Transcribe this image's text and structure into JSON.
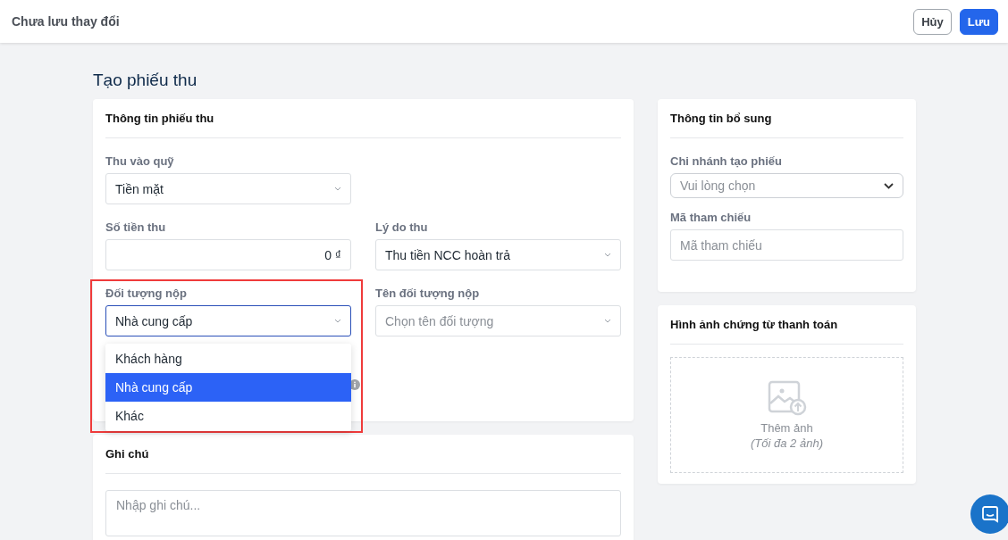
{
  "header": {
    "title": "Chưa lưu thay đổi",
    "buttons": [
      {
        "label": "Hủy",
        "kind": "secondary"
      },
      {
        "label": "Lưu",
        "kind": "primary"
      }
    ]
  },
  "page_title": "Tạo phiếu thu",
  "receipt_card": {
    "title": "Thông tin phiếu thu",
    "fund": {
      "label": "Thu vào quỹ",
      "value": "Tiền mặt"
    },
    "amount": {
      "label": "Số tiền thu",
      "value": "0 ₫"
    },
    "reason": {
      "label": "Lý do thu",
      "value": "Thu tiền NCC hoàn trả"
    },
    "payer_type": {
      "label": "Đối tượng nộp",
      "value": "Nhà cung cấp",
      "focused": true,
      "highlighted": true,
      "options": [
        {
          "label": "Khách hàng",
          "selected": false
        },
        {
          "label": "Nhà cung cấp",
          "selected": true
        },
        {
          "label": "Khác",
          "selected": false
        }
      ]
    },
    "payer_name": {
      "label": "Tên đối tượng nộp",
      "placeholder": "Chọn tên đối tượng"
    }
  },
  "note_card": {
    "title": "Ghi chú",
    "placeholder": "Nhập ghi chú..."
  },
  "extra_card": {
    "title": "Thông tin bổ sung",
    "branch": {
      "label": "Chi nhánh tạo phiếu",
      "placeholder": "Vui lòng chọn"
    },
    "reference": {
      "label": "Mã tham chiếu",
      "placeholder": "Mã tham chiếu"
    }
  },
  "image_card": {
    "title": "Hình ảnh chứng từ thanh toán",
    "upload_label": "Thêm ảnh",
    "upload_hint": "(Tối đa 2 ảnh)"
  }
}
